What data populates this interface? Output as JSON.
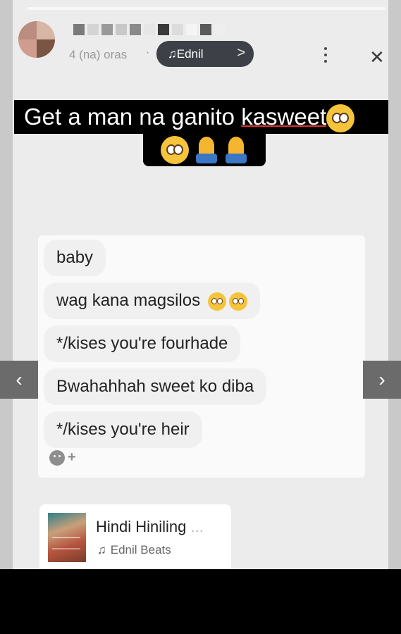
{
  "story": {
    "time": "4 (na) oras",
    "separator": "·",
    "music_pill": "♫Ednil",
    "music_pill_chevron": ">",
    "more_icon": "more-vertical-icon",
    "close_icon": "close-icon",
    "close_glyph": "✕"
  },
  "caption": {
    "line1_text": "Get a man na ganito ",
    "line1_underlined": "kasweet",
    "line2_emojis": [
      "pleading-face-emoji",
      "folded-hands-emoji",
      "folded-hands-emoji"
    ]
  },
  "chat": {
    "messages": [
      {
        "text": "baby",
        "emojis": 0
      },
      {
        "text": "wag kana magsilos",
        "emojis": 2
      },
      {
        "text": "*/kises you're fourhade",
        "emojis": 0
      },
      {
        "text": "Bwahahhah sweet ko diba",
        "emojis": 0
      },
      {
        "text": "*/kises you're heir",
        "emojis": 0
      }
    ],
    "reaction_plus": "+"
  },
  "nav": {
    "prev": "‹",
    "next": "›"
  },
  "music": {
    "title": "Hindi Hiniling",
    "title_ellipsis": "...",
    "artist_icon": "♫",
    "artist": "Ednil Beats"
  },
  "colors": {
    "story_bg": "#ececec",
    "pill_bg": "#3d4046",
    "caption_bg": "#000000",
    "emoji_yellow": "#f6c43a"
  }
}
